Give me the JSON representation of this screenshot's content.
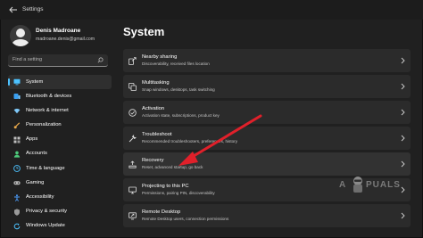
{
  "app": {
    "title": "Settings"
  },
  "user": {
    "name": "Denis Madroane",
    "email": "madroane.denis@gmail.com"
  },
  "search": {
    "placeholder": "Find a setting"
  },
  "sidebar": {
    "items": [
      {
        "label": "System",
        "icon": "monitor-icon",
        "color": "#4cc2ff",
        "active": true
      },
      {
        "label": "Bluetooth & devices",
        "icon": "bluetooth-icon",
        "color": "#3a9ff0"
      },
      {
        "label": "Network & internet",
        "icon": "wifi-icon",
        "color": "#7fc8f8"
      },
      {
        "label": "Personalization",
        "icon": "brush-icon",
        "color": "#e8a84a"
      },
      {
        "label": "Apps",
        "icon": "apps-icon",
        "color": "#c0c0c0"
      },
      {
        "label": "Accounts",
        "icon": "account-icon",
        "color": "#4dc97a"
      },
      {
        "label": "Time & language",
        "icon": "globe-clock-icon",
        "color": "#4cc2ff"
      },
      {
        "label": "Gaming",
        "icon": "controller-icon",
        "color": "#b5b5b5"
      },
      {
        "label": "Accessibility",
        "icon": "accessibility-icon",
        "color": "#4c9fff"
      },
      {
        "label": "Privacy & security",
        "icon": "shield-icon",
        "color": "#9a9a9a"
      },
      {
        "label": "Windows Update",
        "icon": "update-icon",
        "color": "#4cc2ff"
      }
    ]
  },
  "main": {
    "title": "System",
    "cards": [
      {
        "title": "Nearby sharing",
        "desc": "Discoverability, received files location",
        "icon": "share-icon"
      },
      {
        "title": "Multitasking",
        "desc": "Snap windows, desktops, task switching",
        "icon": "multitask-icon"
      },
      {
        "title": "Activation",
        "desc": "Activation state, subscriptions, product key",
        "icon": "checkmark-circle-icon"
      },
      {
        "title": "Troubleshoot",
        "desc": "Recommended troubleshooters, preferences, history",
        "icon": "wrench-icon"
      },
      {
        "title": "Recovery",
        "desc": "Reset, advanced startup, go back",
        "icon": "recovery-icon",
        "highlight": true
      },
      {
        "title": "Projecting to this PC",
        "desc": "Permissions, pairing PIN, discoverability",
        "icon": "projector-icon"
      },
      {
        "title": "Remote Desktop",
        "desc": "Remote Desktop users, connection permissions",
        "icon": "remote-desktop-icon"
      }
    ]
  },
  "annotation": {
    "arrow_color": "#e0202a"
  },
  "watermark": {
    "left": "A",
    "right": "PUALS"
  }
}
